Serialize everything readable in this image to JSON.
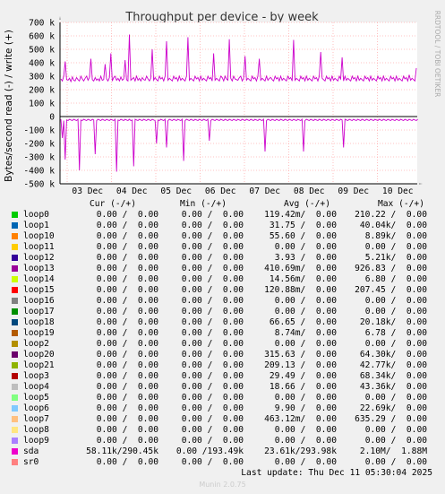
{
  "chart_data": {
    "type": "line",
    "title": "Throughput per device - by week",
    "ylabel": "Bytes/second read (-) / write (+)",
    "side_label": "RRDTOOL / TOBI OETIKER",
    "ylim": [
      -500,
      700
    ],
    "y_ticks": [
      {
        "v": 700,
        "label": "700 k"
      },
      {
        "v": 600,
        "label": "600 k"
      },
      {
        "v": 500,
        "label": "500 k"
      },
      {
        "v": 400,
        "label": "400 k"
      },
      {
        "v": 300,
        "label": "300 k"
      },
      {
        "v": 200,
        "label": "200 k"
      },
      {
        "v": 100,
        "label": "100 k"
      },
      {
        "v": 0,
        "label": "0"
      },
      {
        "v": -100,
        "label": "-100 k"
      },
      {
        "v": -200,
        "label": "-200 k"
      },
      {
        "v": -300,
        "label": "-300 k"
      },
      {
        "v": -400,
        "label": "-400 k"
      },
      {
        "v": -500,
        "label": "-500 k"
      }
    ],
    "x_ticks": [
      "03 Dec",
      "04 Dec",
      "05 Dec",
      "06 Dec",
      "07 Dec",
      "08 Dec",
      "09 Dec",
      "10 Dec"
    ],
    "series": [
      {
        "name": "sda",
        "color": "#cc00cc",
        "write_values": [
          280,
          265,
          300,
          410,
          275,
          270,
          285,
          260,
          295,
          270,
          265,
          290,
          275,
          265,
          300,
          280,
          265,
          285,
          300,
          270,
          290,
          430,
          275,
          265,
          290,
          270,
          280,
          265,
          300,
          270,
          275,
          390,
          280,
          265,
          290,
          470,
          265,
          290,
          300,
          270,
          285,
          265,
          295,
          270,
          280,
          420,
          275,
          265,
          610,
          270,
          280,
          290,
          265,
          300,
          270,
          285,
          265,
          290,
          275,
          270,
          300,
          280,
          265,
          285,
          500,
          270,
          290,
          275,
          265,
          300,
          280,
          290,
          265,
          300,
          560,
          270,
          285,
          275,
          265,
          300,
          280,
          290,
          265,
          300,
          270,
          285,
          275,
          265,
          300,
          590,
          270,
          285,
          275,
          265,
          300,
          280,
          290,
          265,
          300,
          270,
          285,
          275,
          265,
          300,
          280,
          290,
          265,
          470,
          270,
          285,
          275,
          265,
          300,
          290,
          265,
          300,
          280,
          270,
          575,
          285,
          265,
          300,
          280,
          275,
          270,
          290,
          300,
          265,
          285,
          450,
          270,
          285,
          275,
          265,
          300,
          280,
          290,
          265,
          300,
          430,
          270,
          285,
          275,
          265,
          300,
          270,
          285,
          290,
          275,
          265,
          300,
          280,
          290,
          265,
          300,
          270,
          285,
          275,
          265,
          300,
          280,
          290,
          265,
          570,
          270,
          285,
          275,
          265,
          300,
          280,
          290,
          265,
          300,
          270,
          285,
          275,
          265,
          300,
          280,
          290,
          265,
          300,
          480,
          285,
          275,
          265,
          300,
          280,
          290,
          265,
          300,
          270,
          285,
          275,
          265,
          300,
          280,
          440,
          265,
          300,
          270,
          285,
          275,
          265,
          300,
          280,
          290,
          265,
          300,
          270,
          285,
          275,
          265,
          300,
          280,
          290,
          265,
          300,
          270,
          285,
          275,
          265,
          300,
          280,
          290,
          265,
          300,
          270,
          285,
          275,
          265,
          300,
          280,
          290,
          265,
          300,
          270,
          285,
          275,
          265,
          300,
          280,
          290,
          265,
          310,
          270,
          285,
          275,
          265,
          360
        ],
        "read_values": [
          -20,
          -160,
          -30,
          -320,
          -25,
          -30,
          -20,
          -25,
          -30,
          -20,
          -25,
          -30,
          -20,
          -400,
          -25,
          -30,
          -20,
          -25,
          -30,
          -20,
          -25,
          -30,
          -20,
          -25,
          -280,
          -30,
          -20,
          -25,
          -30,
          -20,
          -25,
          -30,
          -20,
          -25,
          -30,
          -20,
          -25,
          -30,
          -20,
          -410,
          -25,
          -30,
          -20,
          -25,
          -30,
          -20,
          -25,
          -30,
          -20,
          -30,
          -25,
          -370,
          -20,
          -25,
          -30,
          -20,
          -25,
          -30,
          -20,
          -25,
          -30,
          -20,
          -25,
          -30,
          -20,
          -25,
          -30,
          -200,
          -25,
          -30,
          -20,
          -25,
          -30,
          -20,
          -230,
          -30,
          -20,
          -25,
          -30,
          -20,
          -25,
          -30,
          -20,
          -25,
          -30,
          -20,
          -330,
          -30,
          -20,
          -25,
          -30,
          -20,
          -25,
          -30,
          -20,
          -25,
          -30,
          -20,
          -25,
          -30,
          -20,
          -25,
          -30,
          -20,
          -180,
          -30,
          -20,
          -25,
          -30,
          -20,
          -25,
          -30,
          -20,
          -25,
          -30,
          -20,
          -25,
          -30,
          -20,
          -25,
          -30,
          -20,
          -25,
          -30,
          -20,
          -25,
          -30,
          -20,
          -25,
          -30,
          -20,
          -25,
          -30,
          -20,
          -25,
          -30,
          -20,
          -25,
          -30,
          -20,
          -25,
          -30,
          -20,
          -260,
          -30,
          -20,
          -25,
          -30,
          -20,
          -25,
          -30,
          -20,
          -25,
          -30,
          -20,
          -25,
          -30,
          -20,
          -25,
          -30,
          -20,
          -25,
          -30,
          -20,
          -25,
          -30,
          -20,
          -25,
          -30,
          -20,
          -260,
          -30,
          -20,
          -25,
          -30,
          -20,
          -25,
          -30,
          -20,
          -25,
          -30,
          -20,
          -25,
          -30,
          -20,
          -25,
          -30,
          -20,
          -25,
          -30,
          -20,
          -25,
          -30,
          -20,
          -25,
          -30,
          -20,
          -25,
          -230,
          -20,
          -25,
          -30,
          -20,
          -25,
          -30,
          -20,
          -25,
          -30,
          -20,
          -25,
          -30,
          -20,
          -25,
          -30,
          -20,
          -25,
          -30,
          -20,
          -25,
          -30,
          -20,
          -25,
          -30,
          -20,
          -25,
          -30,
          -20,
          -25,
          -30,
          -20,
          -25,
          -30,
          -20,
          -25,
          -30,
          -20,
          -25,
          -30,
          -20,
          -25,
          -30,
          -20,
          -25,
          -30,
          -20,
          -25,
          -30,
          -20,
          -25,
          -30,
          -20
        ]
      }
    ],
    "grid": true
  },
  "legend": {
    "headers": {
      "cur": "Cur (-/+)",
      "min": "Min (-/+)",
      "avg": "Avg (-/+)",
      "max": "Max (-/+)"
    },
    "rows": [
      {
        "name": "loop0",
        "color": "#00cc00",
        "cur": "0.00 /  0.00",
        "min": "0.00 /  0.00",
        "avg": "119.42m/  0.00",
        "max": "210.22 /  0.00"
      },
      {
        "name": "loop1",
        "color": "#0066b3",
        "cur": "0.00 /  0.00",
        "min": "0.00 /  0.00",
        "avg": "31.75 /  0.00",
        "max": "40.04k/  0.00"
      },
      {
        "name": "loop10",
        "color": "#ff8000",
        "cur": "0.00 /  0.00",
        "min": "0.00 /  0.00",
        "avg": "55.60 /  0.00",
        "max": "8.89k/  0.00"
      },
      {
        "name": "loop11",
        "color": "#ffcc00",
        "cur": "0.00 /  0.00",
        "min": "0.00 /  0.00",
        "avg": "0.00 /  0.00",
        "max": "0.00 /  0.00"
      },
      {
        "name": "loop12",
        "color": "#330099",
        "cur": "0.00 /  0.00",
        "min": "0.00 /  0.00",
        "avg": "3.93 /  0.00",
        "max": "5.21k/  0.00"
      },
      {
        "name": "loop13",
        "color": "#990099",
        "cur": "0.00 /  0.00",
        "min": "0.00 /  0.00",
        "avg": "410.69m/  0.00",
        "max": "926.83 /  0.00"
      },
      {
        "name": "loop14",
        "color": "#ccff00",
        "cur": "0.00 /  0.00",
        "min": "0.00 /  0.00",
        "avg": "14.56m/  0.00",
        "max": "6.80 /  0.00"
      },
      {
        "name": "loop15",
        "color": "#ff0000",
        "cur": "0.00 /  0.00",
        "min": "0.00 /  0.00",
        "avg": "120.88m/  0.00",
        "max": "207.45 /  0.00"
      },
      {
        "name": "loop16",
        "color": "#808080",
        "cur": "0.00 /  0.00",
        "min": "0.00 /  0.00",
        "avg": "0.00 /  0.00",
        "max": "0.00 /  0.00"
      },
      {
        "name": "loop17",
        "color": "#008f00",
        "cur": "0.00 /  0.00",
        "min": "0.00 /  0.00",
        "avg": "0.00 /  0.00",
        "max": "0.00 /  0.00"
      },
      {
        "name": "loop18",
        "color": "#00487d",
        "cur": "0.00 /  0.00",
        "min": "0.00 /  0.00",
        "avg": "66.65 /  0.00",
        "max": "20.18k/  0.00"
      },
      {
        "name": "loop19",
        "color": "#b35a00",
        "cur": "0.00 /  0.00",
        "min": "0.00 /  0.00",
        "avg": "8.74m/  0.00",
        "max": "6.78 /  0.00"
      },
      {
        "name": "loop2",
        "color": "#b38f00",
        "cur": "0.00 /  0.00",
        "min": "0.00 /  0.00",
        "avg": "0.00 /  0.00",
        "max": "0.00 /  0.00"
      },
      {
        "name": "loop20",
        "color": "#6b006b",
        "cur": "0.00 /  0.00",
        "min": "0.00 /  0.00",
        "avg": "315.63 /  0.00",
        "max": "64.30k/  0.00"
      },
      {
        "name": "loop21",
        "color": "#8fb300",
        "cur": "0.00 /  0.00",
        "min": "0.00 /  0.00",
        "avg": "209.13 /  0.00",
        "max": "42.77k/  0.00"
      },
      {
        "name": "loop3",
        "color": "#b30000",
        "cur": "0.00 /  0.00",
        "min": "0.00 /  0.00",
        "avg": "29.49 /  0.00",
        "max": "68.34k/  0.00"
      },
      {
        "name": "loop4",
        "color": "#bebebe",
        "cur": "0.00 /  0.00",
        "min": "0.00 /  0.00",
        "avg": "18.66 /  0.00",
        "max": "43.36k/  0.00"
      },
      {
        "name": "loop5",
        "color": "#80ff80",
        "cur": "0.00 /  0.00",
        "min": "0.00 /  0.00",
        "avg": "0.00 /  0.00",
        "max": "0.00 /  0.00"
      },
      {
        "name": "loop6",
        "color": "#80c9ff",
        "cur": "0.00 /  0.00",
        "min": "0.00 /  0.00",
        "avg": "9.90 /  0.00",
        "max": "22.69k/  0.00"
      },
      {
        "name": "loop7",
        "color": "#ffc080",
        "cur": "0.00 /  0.00",
        "min": "0.00 /  0.00",
        "avg": "463.12m/  0.00",
        "max": "635.29 /  0.00"
      },
      {
        "name": "loop8",
        "color": "#ffe680",
        "cur": "0.00 /  0.00",
        "min": "0.00 /  0.00",
        "avg": "0.00 /  0.00",
        "max": "0.00 /  0.00"
      },
      {
        "name": "loop9",
        "color": "#aa80ff",
        "cur": "0.00 /  0.00",
        "min": "0.00 /  0.00",
        "avg": "0.00 /  0.00",
        "max": "0.00 /  0.00"
      },
      {
        "name": "sda",
        "color": "#ee00cc",
        "cur": "58.11k/290.45k",
        "min": "0.00 /193.49k",
        "avg": "23.61k/293.98k",
        "max": "2.10M/  1.88M"
      },
      {
        "name": "sr0",
        "color": "#ff8080",
        "cur": "0.00 /  0.00",
        "min": "0.00 /  0.00",
        "avg": "0.00 /  0.00",
        "max": "0.00 /  0.00"
      }
    ]
  },
  "footer": {
    "last_update": "Last update: Thu Dec 11 05:30:04 2025",
    "munin": "Munin 2.0.75"
  }
}
